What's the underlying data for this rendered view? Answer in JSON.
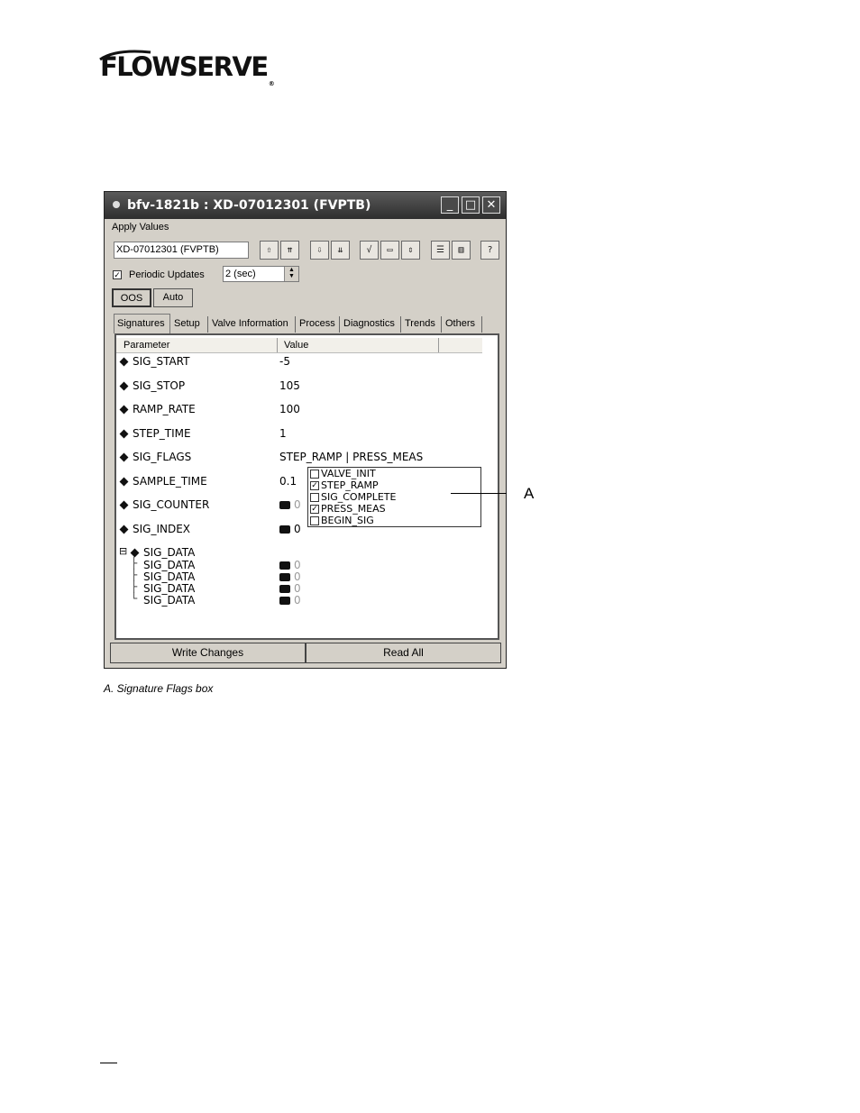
{
  "logo": {
    "text": "FLOWSERVE",
    "registered": "®"
  },
  "window": {
    "title": "bfv-1821b : XD-07012301 (FVPTB)",
    "buttons": [
      "_",
      "□",
      "✕"
    ],
    "menu": "Apply Values",
    "block_select": "XD-07012301 (FVPTB)",
    "periodic_updates": {
      "label": "Periodic Updates",
      "checked": true,
      "interval": "2 (sec)"
    },
    "modes": [
      "OOS",
      "Auto"
    ],
    "tabs": [
      "Signatures",
      "Setup",
      "Valve Information",
      "Process",
      "Diagnostics",
      "Trends",
      "Others"
    ],
    "grid": {
      "headers": [
        "Parameter",
        "Value"
      ],
      "rows": [
        {
          "name": "SIG_START",
          "value": "-5"
        },
        {
          "name": "SIG_STOP",
          "value": "105"
        },
        {
          "name": "RAMP_RATE",
          "value": "100"
        },
        {
          "name": "STEP_TIME",
          "value": "1"
        },
        {
          "name": "SIG_FLAGS",
          "value": "STEP_RAMP | PRESS_MEAS"
        },
        {
          "name": "SAMPLE_TIME",
          "value": "0.1"
        },
        {
          "name": "SIG_COUNTER",
          "value": "0"
        },
        {
          "name": "SIG_INDEX",
          "value": "0"
        },
        {
          "name": "SIG_DATA",
          "value": ""
        }
      ],
      "children": [
        {
          "name": "SIG_DATA",
          "value": "0"
        },
        {
          "name": "SIG_DATA",
          "value": "0"
        },
        {
          "name": "SIG_DATA",
          "value": "0"
        },
        {
          "name": "SIG_DATA",
          "value": "0"
        }
      ]
    },
    "flags": [
      {
        "label": "VALVE_INIT",
        "checked": false
      },
      {
        "label": "STEP_RAMP",
        "checked": true
      },
      {
        "label": "SIG_COMPLETE",
        "checked": false
      },
      {
        "label": "PRESS_MEAS",
        "checked": true
      },
      {
        "label": "BEGIN_SIG",
        "checked": false
      }
    ],
    "write_button": "Write Changes",
    "read_button": "Read All"
  },
  "callout": "A",
  "caption": "A. Signature Flags box"
}
